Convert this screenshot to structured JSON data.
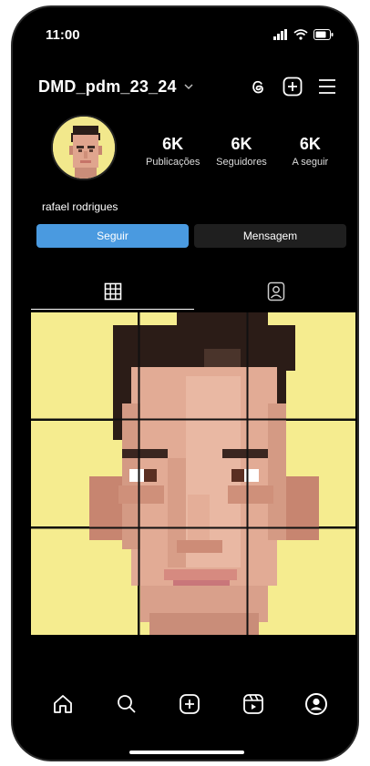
{
  "status_bar": {
    "time": "11:00"
  },
  "header": {
    "username": "DMD_pdm_23_24"
  },
  "profile": {
    "name": "rafael rodrigues",
    "stats": [
      {
        "value": "6K",
        "label": "Publicações"
      },
      {
        "value": "6K",
        "label": "Seguidores"
      },
      {
        "value": "6K",
        "label": "A seguir"
      }
    ]
  },
  "actions": {
    "follow_label": "Seguir",
    "message_label": "Mensagem"
  },
  "tabs": [
    {
      "icon": "grid-icon",
      "active": true
    },
    {
      "icon": "tagged-person-icon",
      "active": false
    }
  ],
  "posts": {
    "count": 9
  },
  "bottom_nav": [
    {
      "icon": "home-icon"
    },
    {
      "icon": "search-icon"
    },
    {
      "icon": "add-post-icon"
    },
    {
      "icon": "reels-icon"
    },
    {
      "icon": "profile-icon"
    }
  ],
  "colors": {
    "background": "#000000",
    "follow_button": "#4a9ae0",
    "message_button": "#1f1f1f",
    "grid_background": "#f5ec8f"
  }
}
